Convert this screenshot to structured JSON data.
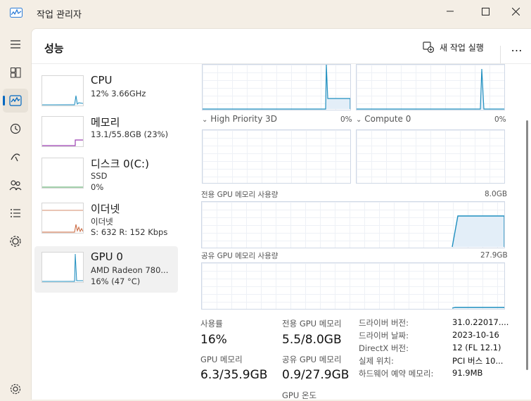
{
  "window": {
    "title": "작업 관리자"
  },
  "header": {
    "title": "성능",
    "run_new_task": "새 작업 실행",
    "more": "…"
  },
  "rail": {
    "items": [
      {
        "name": "menu-icon"
      },
      {
        "name": "processes-icon"
      },
      {
        "name": "performance-icon"
      },
      {
        "name": "app-history-icon"
      },
      {
        "name": "startup-apps-icon"
      },
      {
        "name": "users-icon"
      },
      {
        "name": "details-icon"
      },
      {
        "name": "services-icon"
      },
      {
        "name": "settings-icon"
      }
    ]
  },
  "left_list": [
    {
      "name": "CPU",
      "line2": "12%  3.66GHz",
      "line3": "",
      "color": "#1f8fbf"
    },
    {
      "name": "메모리",
      "line2": "13.1/55.8GB (23%)",
      "line3": "",
      "color": "#9a3fb0"
    },
    {
      "name": "디스크 0(C:)",
      "line2": "SSD",
      "line3": "0%",
      "color": "#4aa35a"
    },
    {
      "name": "이더넷",
      "line2": "이더넷",
      "line3": "S: 632  R: 152 Kbps",
      "color": "#c8643a"
    },
    {
      "name": "GPU 0",
      "line2": "AMD Radeon 780...",
      "line3": "16% (47 °C)",
      "color": "#1f8fbf"
    }
  ],
  "engines": [
    {
      "label": "High Priority 3D",
      "pct": "0%"
    },
    {
      "label": "Compute 0",
      "pct": "0%"
    }
  ],
  "dedicated_memory": {
    "label": "전용 GPU 메모리 사용량",
    "max": "8.0GB"
  },
  "shared_memory": {
    "label": "공유 GPU 메모리 사용량",
    "max": "27.9GB"
  },
  "stats": {
    "utilization": {
      "label": "사용률",
      "value": "16%"
    },
    "dedicated": {
      "label": "전용 GPU 메모리",
      "value": "5.5/8.0GB"
    },
    "gpu_memory": {
      "label": "GPU 메모리",
      "value": "6.3/35.9GB"
    },
    "shared": {
      "label": "공유 GPU 메모리",
      "value": "0.9/27.9GB"
    },
    "temp": {
      "label": "GPU 온도"
    }
  },
  "info": [
    {
      "k": "드라이버 버전:",
      "v": "31.0.22017...."
    },
    {
      "k": "드라이버 날짜:",
      "v": "2023-10-16"
    },
    {
      "k": "DirectX 버전:",
      "v": "12 (FL 12.1)"
    },
    {
      "k": "실제 위치:",
      "v": "PCI 버스 10..."
    },
    {
      "k": "하드웨어 예약 메모리:",
      "v": "91.9MB"
    }
  ],
  "colors": {
    "accent": "#0067c0",
    "gpu_line": "#1f8fbf",
    "gpu_fill": "#e3eef8"
  }
}
